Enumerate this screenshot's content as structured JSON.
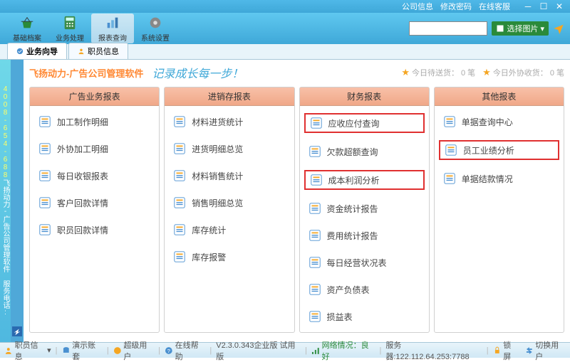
{
  "titlebar": {
    "links": [
      "公司信息",
      "修改密码",
      "在线客服"
    ]
  },
  "toolbar": {
    "buttons": [
      {
        "label": "基础档案"
      },
      {
        "label": "业务处理"
      },
      {
        "label": "报表查询"
      },
      {
        "label": "系统设置"
      }
    ],
    "search_placeholder": "",
    "pic_button": "选择图片"
  },
  "tabs": [
    {
      "label": "业务向导"
    },
    {
      "label": "职员信息"
    }
  ],
  "side_text_yellow": "4008-654-688",
  "side_text_white": "飞扬动力-广告公司管理软件 服务电话:",
  "header": {
    "title": "飞扬动力-广告公司管理软件",
    "slogan": "记录成长每一步！",
    "pending_delivery_label": "今日待送货：",
    "pending_delivery_count": "0 笔",
    "out_collect_label": "今日外协收货：",
    "out_collect_count": "0 笔"
  },
  "panels": [
    {
      "title": "广告业务报表",
      "items": [
        {
          "label": "加工制作明细",
          "boxed": false
        },
        {
          "label": "外协加工明细",
          "boxed": false
        },
        {
          "label": "每日收银报表",
          "boxed": false
        },
        {
          "label": "客户回款详情",
          "boxed": false
        },
        {
          "label": "职员回款详情",
          "boxed": false
        }
      ]
    },
    {
      "title": "进销存报表",
      "items": [
        {
          "label": "材料进货统计",
          "boxed": false
        },
        {
          "label": "进货明细总览",
          "boxed": false
        },
        {
          "label": "材料销售统计",
          "boxed": false
        },
        {
          "label": "销售明细总览",
          "boxed": false
        },
        {
          "label": "库存统计",
          "boxed": false
        },
        {
          "label": "库存报警",
          "boxed": false
        }
      ]
    },
    {
      "title": "财务报表",
      "items": [
        {
          "label": "应收应付查询",
          "boxed": true
        },
        {
          "label": "欠款超额查询",
          "boxed": false
        },
        {
          "label": "成本利润分析",
          "boxed": true
        },
        {
          "label": "资金统计报告",
          "boxed": false
        },
        {
          "label": "费用统计报告",
          "boxed": false
        },
        {
          "label": "每日经营状况表",
          "boxed": false
        },
        {
          "label": "资产负债表",
          "boxed": false
        },
        {
          "label": "损益表",
          "boxed": false
        }
      ]
    },
    {
      "title": "其他报表",
      "items": [
        {
          "label": "单据查询中心",
          "boxed": false
        },
        {
          "label": "员工业绩分析",
          "boxed": true
        },
        {
          "label": "单据结款情况",
          "boxed": false
        }
      ]
    }
  ],
  "statusbar": {
    "user_info": "职员信息",
    "demo_account": "演示账套",
    "super_user": "超级用户",
    "online_support": "在线帮助",
    "version": "V2.3.0.343企业版 试用版",
    "network_label": "网络情况：",
    "network_status": "良好",
    "server_label": "服务器:",
    "server_value": "122.112.64.253:7788",
    "lock_screen": "锁 屏",
    "switch_user": "切换用户"
  }
}
